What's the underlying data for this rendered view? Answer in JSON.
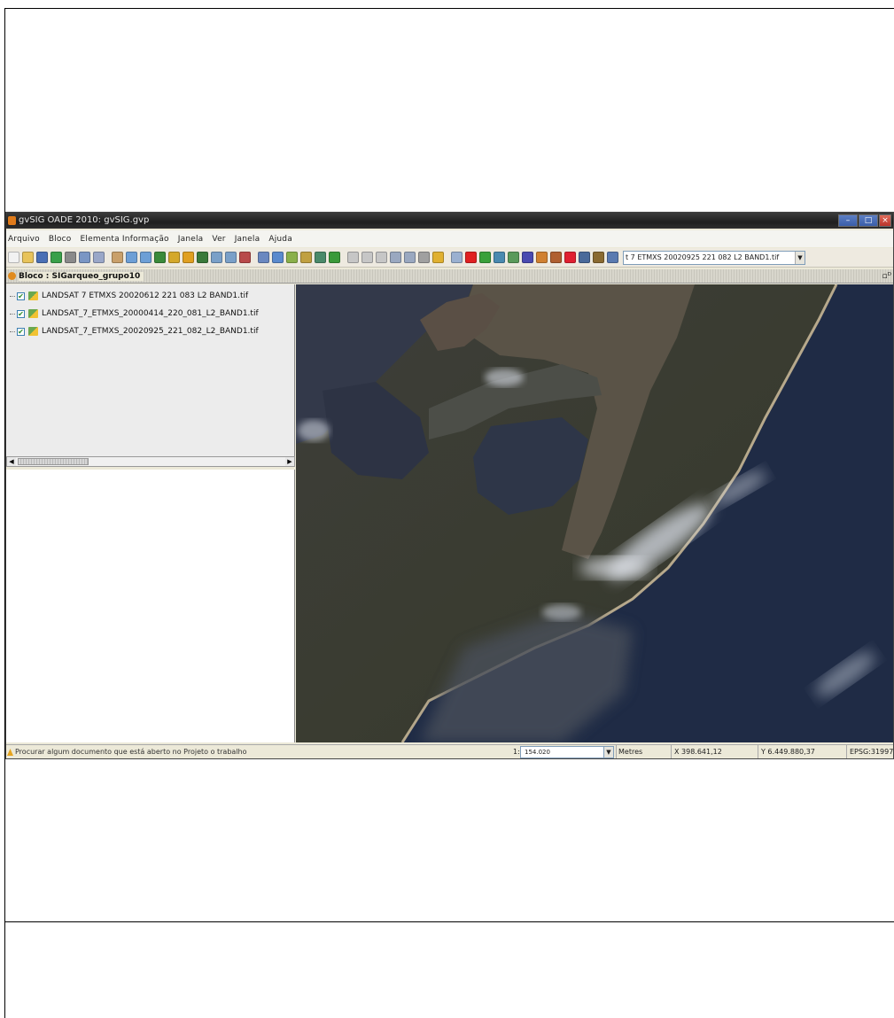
{
  "window": {
    "title": "gvSIG OADE 2010: gvSIG.gvp",
    "controls": [
      "–",
      "□",
      "×"
    ]
  },
  "menu": [
    "Arquivo",
    "Bloco",
    "Elementa Informação",
    "Janela",
    "Ver",
    "Janela",
    "Ajuda"
  ],
  "toolbar": {
    "icons": [
      {
        "name": "new-doc-icon",
        "color": "#f2f2f2"
      },
      {
        "name": "open-folder-icon",
        "color": "#e8c35a"
      },
      {
        "name": "save-icon",
        "color": "#4a6fb5"
      },
      {
        "name": "add-layer-icon",
        "color": "#3aa04a"
      },
      {
        "name": "print-icon",
        "color": "#8a8a8a"
      },
      {
        "name": "print-preview-icon",
        "color": "#7a96c4"
      },
      {
        "name": "layout-icon",
        "color": "#9aa7c8"
      },
      {
        "name": "pan-icon",
        "color": "#c9a06a"
      },
      {
        "name": "zoom-in-icon",
        "color": "#6d9fd6"
      },
      {
        "name": "zoom-out-icon",
        "color": "#6d9fd6"
      },
      {
        "name": "zoom-extent-icon",
        "color": "#3a8a3a"
      },
      {
        "name": "zoom-layer-icon",
        "color": "#d4a82a"
      },
      {
        "name": "zoom-select-icon",
        "color": "#e0a020"
      },
      {
        "name": "globe-icon",
        "color": "#3a7a3a"
      },
      {
        "name": "zoom-previous-icon",
        "color": "#7aa0c8"
      },
      {
        "name": "zoom-next-icon",
        "color": "#7aa0c8"
      },
      {
        "name": "measure-icon",
        "color": "#b84a4a"
      },
      {
        "name": "query-icon",
        "color": "#6a88c0"
      },
      {
        "name": "info-icon",
        "color": "#5a8acd"
      },
      {
        "name": "select-icon",
        "color": "#8ab04a"
      },
      {
        "name": "table-icon",
        "color": "#c0a040"
      },
      {
        "name": "graph-icon",
        "color": "#4a8a6a"
      },
      {
        "name": "edit-icon",
        "color": "#3a9a3a"
      },
      {
        "name": "cursor-icon",
        "color": "#c6c6c6"
      },
      {
        "name": "circle-icon",
        "color": "#c6c6c6"
      },
      {
        "name": "rect-icon",
        "color": "#c6c6c6"
      },
      {
        "name": "select-point-icon",
        "color": "#9aa8c0"
      },
      {
        "name": "select-poly-icon",
        "color": "#9aa8c0"
      },
      {
        "name": "gear-icon",
        "color": "#a0a0a0"
      },
      {
        "name": "grid-icon",
        "color": "#e0b030"
      },
      {
        "name": "raster-icon",
        "color": "#9ab0d0"
      },
      {
        "name": "cross-icon",
        "color": "#e02020"
      },
      {
        "name": "georef-icon",
        "color": "#3aa03a"
      },
      {
        "name": "layers-icon",
        "color": "#4a8ab0"
      },
      {
        "name": "histogram-icon",
        "color": "#5a9a5a"
      },
      {
        "name": "band-icon",
        "color": "#4a4ab0"
      },
      {
        "name": "brush-icon",
        "color": "#d08030"
      },
      {
        "name": "filter-icon",
        "color": "#b06030"
      },
      {
        "name": "target-icon",
        "color": "#e02030"
      },
      {
        "name": "clip-icon",
        "color": "#4a6a9a"
      },
      {
        "name": "rgb-icon",
        "color": "#8a6a30"
      },
      {
        "name": "stack-icon",
        "color": "#5a7ab0"
      }
    ],
    "layer_select": "t 7 ETMXS 20020925 221 082 L2 BAND1.tif",
    "layer_select_arrow": "▼"
  },
  "view": {
    "title": "Bloco : SIGarqueo_grupo10",
    "corner": "▫ᴰ"
  },
  "toc": {
    "layers": [
      {
        "checked": "✔",
        "label": "LANDSAT 7 ETMXS 20020612 221 083 L2 BAND1.tif"
      },
      {
        "checked": "✔",
        "label": "LANDSAT_7_ETMXS_20000414_220_081_L2_BAND1.tif"
      },
      {
        "checked": "✔",
        "label": "LANDSAT_7_ETMXS_20020925_221_082_L2_BAND1.tif"
      }
    ],
    "scroll_left": "◀",
    "scroll_right": "▶"
  },
  "status": {
    "message": "Procurar algum documento que está aberto no Projeto o trabalho",
    "scale_prefix": "1:",
    "scale": "154.020",
    "scale_arrow": "▼",
    "units": "Metres",
    "x": "X 398.641,12",
    "y": "Y 6.449.880,37",
    "crs": "EPSG:31997"
  },
  "colors": {
    "ocean": "#1f2b45",
    "land": "#3a3b35",
    "lagoon": "#3f4450",
    "cloud": "#d8dde6",
    "beach": "#b7a98c"
  }
}
